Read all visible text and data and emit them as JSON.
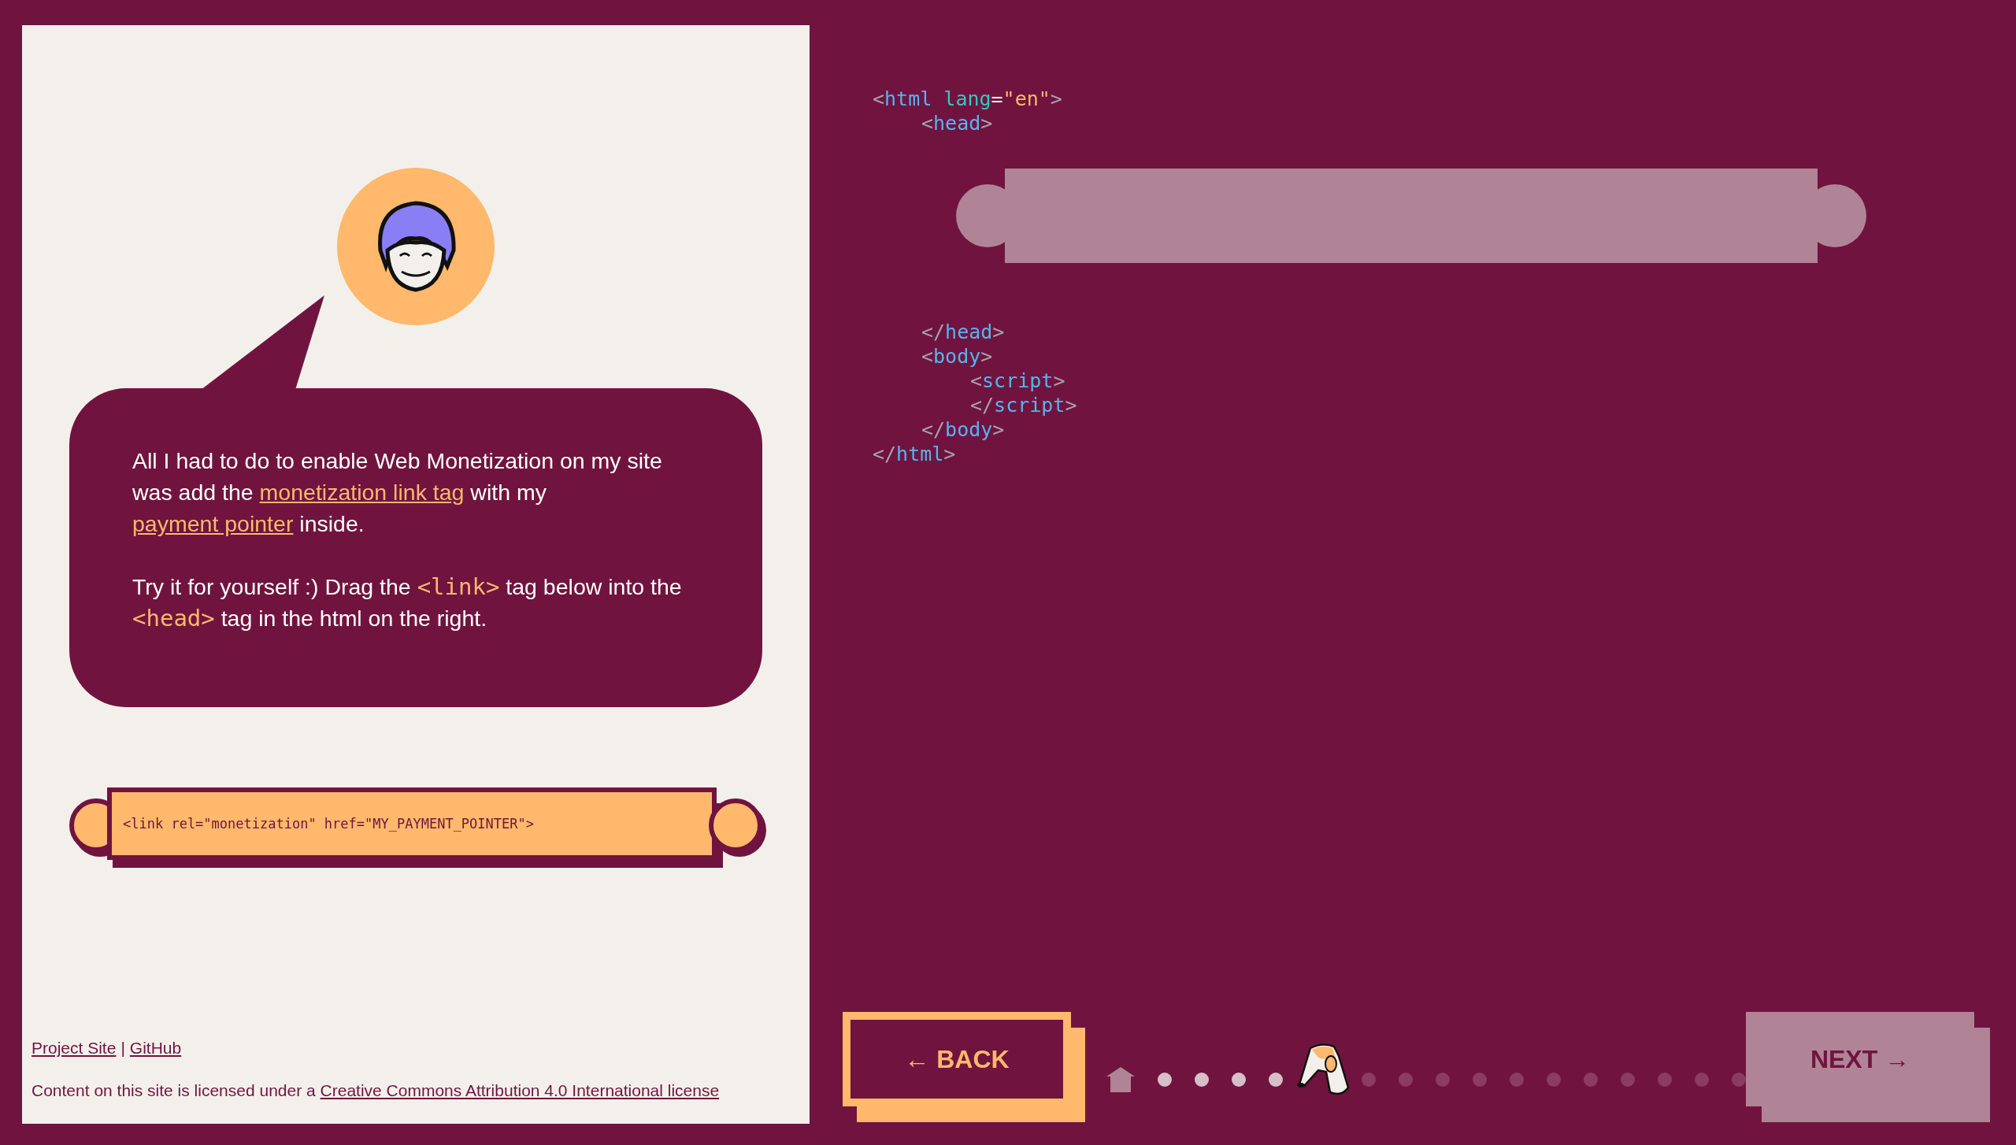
{
  "bubble": {
    "paragraphs": [
      [
        {
          "kind": "text",
          "text": "All I had to do to enable Web Monetization on my site was add the "
        },
        {
          "kind": "link",
          "text": "monetization link tag"
        },
        {
          "kind": "text",
          "text": " with my "
        },
        {
          "kind": "link",
          "text": "payment pointer"
        },
        {
          "kind": "text",
          "text": " inside."
        }
      ],
      [
        {
          "kind": "text",
          "text": "Try it for yourself :) Drag the "
        },
        {
          "kind": "code",
          "text": "<link>"
        },
        {
          "kind": "text",
          "text": " tag below into the "
        },
        {
          "kind": "code",
          "text": "<head>"
        },
        {
          "kind": "text",
          "text": " tag in the html on the right."
        }
      ]
    ]
  },
  "tag_piece": {
    "text": "<link rel=\"monetization\" href=\"MY_PAYMENT_POINTER\">"
  },
  "footer": {
    "links": [
      {
        "kind": "link",
        "text": "Project Site"
      },
      {
        "kind": "sep",
        "text": "|"
      },
      {
        "kind": "link",
        "text": "GitHub"
      }
    ],
    "license": [
      {
        "kind": "text",
        "text": "Content on this site is licensed under a "
      },
      {
        "kind": "link",
        "text": "Creative Commons Attribution 4.0 International license"
      }
    ]
  },
  "code": [
    {
      "kind": "element",
      "open": [
        {
          "kind": "punct",
          "t": "<"
        },
        {
          "kind": "tag",
          "t": "html"
        },
        {
          "kind": "attr",
          "t": "lang"
        },
        {
          "kind": "eq",
          "t": "="
        },
        {
          "kind": "string",
          "t": "\"en\""
        },
        {
          "kind": "punct",
          "t": ">"
        }
      ],
      "close": [
        {
          "kind": "punct",
          "t": "</"
        },
        {
          "kind": "tag",
          "t": "html"
        },
        {
          "kind": "punct",
          "t": ">"
        }
      ],
      "children": [
        {
          "kind": "element",
          "open": [
            {
              "kind": "punct",
              "t": "<"
            },
            {
              "kind": "tag",
              "t": "head"
            },
            {
              "kind": "punct",
              "t": ">"
            }
          ],
          "close": [
            {
              "kind": "punct",
              "t": "</"
            },
            {
              "kind": "tag",
              "t": "head"
            },
            {
              "kind": "punct",
              "t": ">"
            }
          ],
          "children": [
            {
              "kind": "dropzone"
            }
          ]
        },
        {
          "kind": "element",
          "open": [
            {
              "kind": "punct",
              "t": "<"
            },
            {
              "kind": "tag",
              "t": "body"
            },
            {
              "kind": "punct",
              "t": ">"
            }
          ],
          "close": [
            {
              "kind": "punct",
              "t": "</"
            },
            {
              "kind": "tag",
              "t": "body"
            },
            {
              "kind": "punct",
              "t": ">"
            }
          ],
          "children": [
            {
              "kind": "element",
              "open": [
                {
                  "kind": "punct",
                  "t": "<"
                },
                {
                  "kind": "tag",
                  "t": "script"
                },
                {
                  "kind": "punct",
                  "t": ">"
                }
              ],
              "close": [
                {
                  "kind": "punct",
                  "t": "</"
                },
                {
                  "kind": "tag",
                  "t": "script"
                },
                {
                  "kind": "punct",
                  "t": ">"
                }
              ]
            }
          ]
        }
      ]
    }
  ],
  "back_button": {
    "label": "← BACK"
  },
  "steps": [
    {
      "kind": "home"
    },
    {
      "kind": "dot",
      "done": true
    },
    {
      "kind": "dot",
      "done": true
    },
    {
      "kind": "dot",
      "done": true
    },
    {
      "kind": "dot",
      "done": true
    },
    {
      "kind": "current"
    },
    {
      "kind": "dot",
      "done": false
    },
    {
      "kind": "dot",
      "done": false
    },
    {
      "kind": "dot",
      "done": false
    },
    {
      "kind": "dot",
      "done": false
    },
    {
      "kind": "dot",
      "done": false
    },
    {
      "kind": "dot",
      "done": false
    },
    {
      "kind": "dot",
      "done": false
    },
    {
      "kind": "dot",
      "done": false
    },
    {
      "kind": "dot",
      "done": false
    },
    {
      "kind": "dot",
      "done": false
    },
    {
      "kind": "dot",
      "done": false
    }
  ],
  "next_button": {
    "label": "NEXT →"
  }
}
